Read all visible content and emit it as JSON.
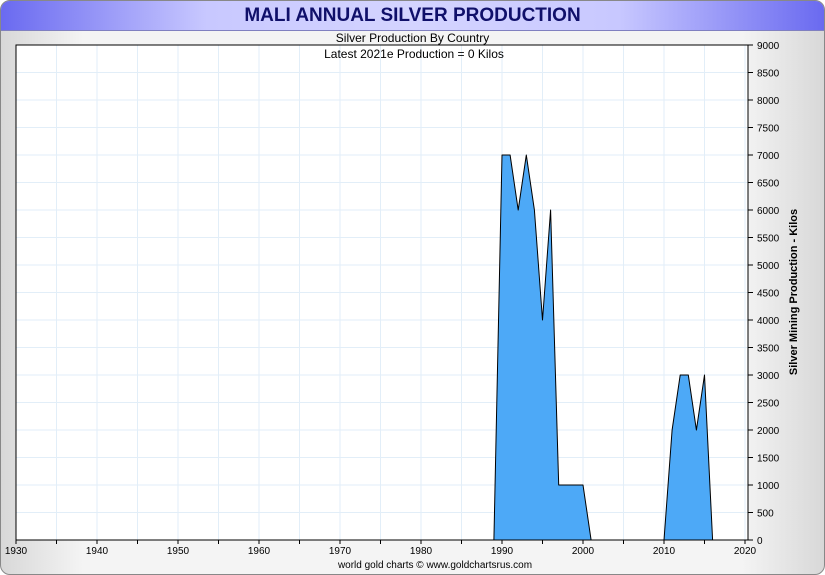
{
  "chart_data": {
    "type": "area",
    "title": "MALI ANNUAL SILVER PRODUCTION",
    "subtitle": "Silver Production By Country",
    "annotation": "Latest 2021e Production = 0 Kilos",
    "ylabel": "Silver Mining Production - Kilos",
    "xlabel": "",
    "footer": "world gold charts © www.goldchartsrus.com",
    "xlim": [
      1930,
      2020
    ],
    "ylim": [
      0,
      9000
    ],
    "x_ticks": [
      "1930",
      "1940",
      "1950",
      "1960",
      "1970",
      "1980",
      "1990",
      "2000",
      "2010",
      "2020"
    ],
    "y_ticks": [
      "0",
      "500",
      "1000",
      "1500",
      "2000",
      "2500",
      "3000",
      "3500",
      "4000",
      "4500",
      "5000",
      "5500",
      "6000",
      "6500",
      "7000",
      "7500",
      "8000",
      "8500",
      "9000"
    ],
    "grid": true,
    "fill_color": "#4da9f7",
    "series": [
      {
        "name": "Mali",
        "x": [
          1989,
          1990,
          1991,
          1992,
          1993,
          1994,
          1995,
          1996,
          1997,
          1998,
          1999,
          2000,
          2001
        ],
        "y": [
          0,
          7000,
          7000,
          6000,
          7000,
          6000,
          4000,
          6000,
          1000,
          1000,
          1000,
          1000,
          0
        ]
      },
      {
        "name": "Mali",
        "x": [
          2010,
          2011,
          2012,
          2013,
          2014,
          2015,
          2016
        ],
        "y": [
          0,
          2000,
          3000,
          3000,
          2000,
          3000,
          0
        ]
      }
    ]
  }
}
